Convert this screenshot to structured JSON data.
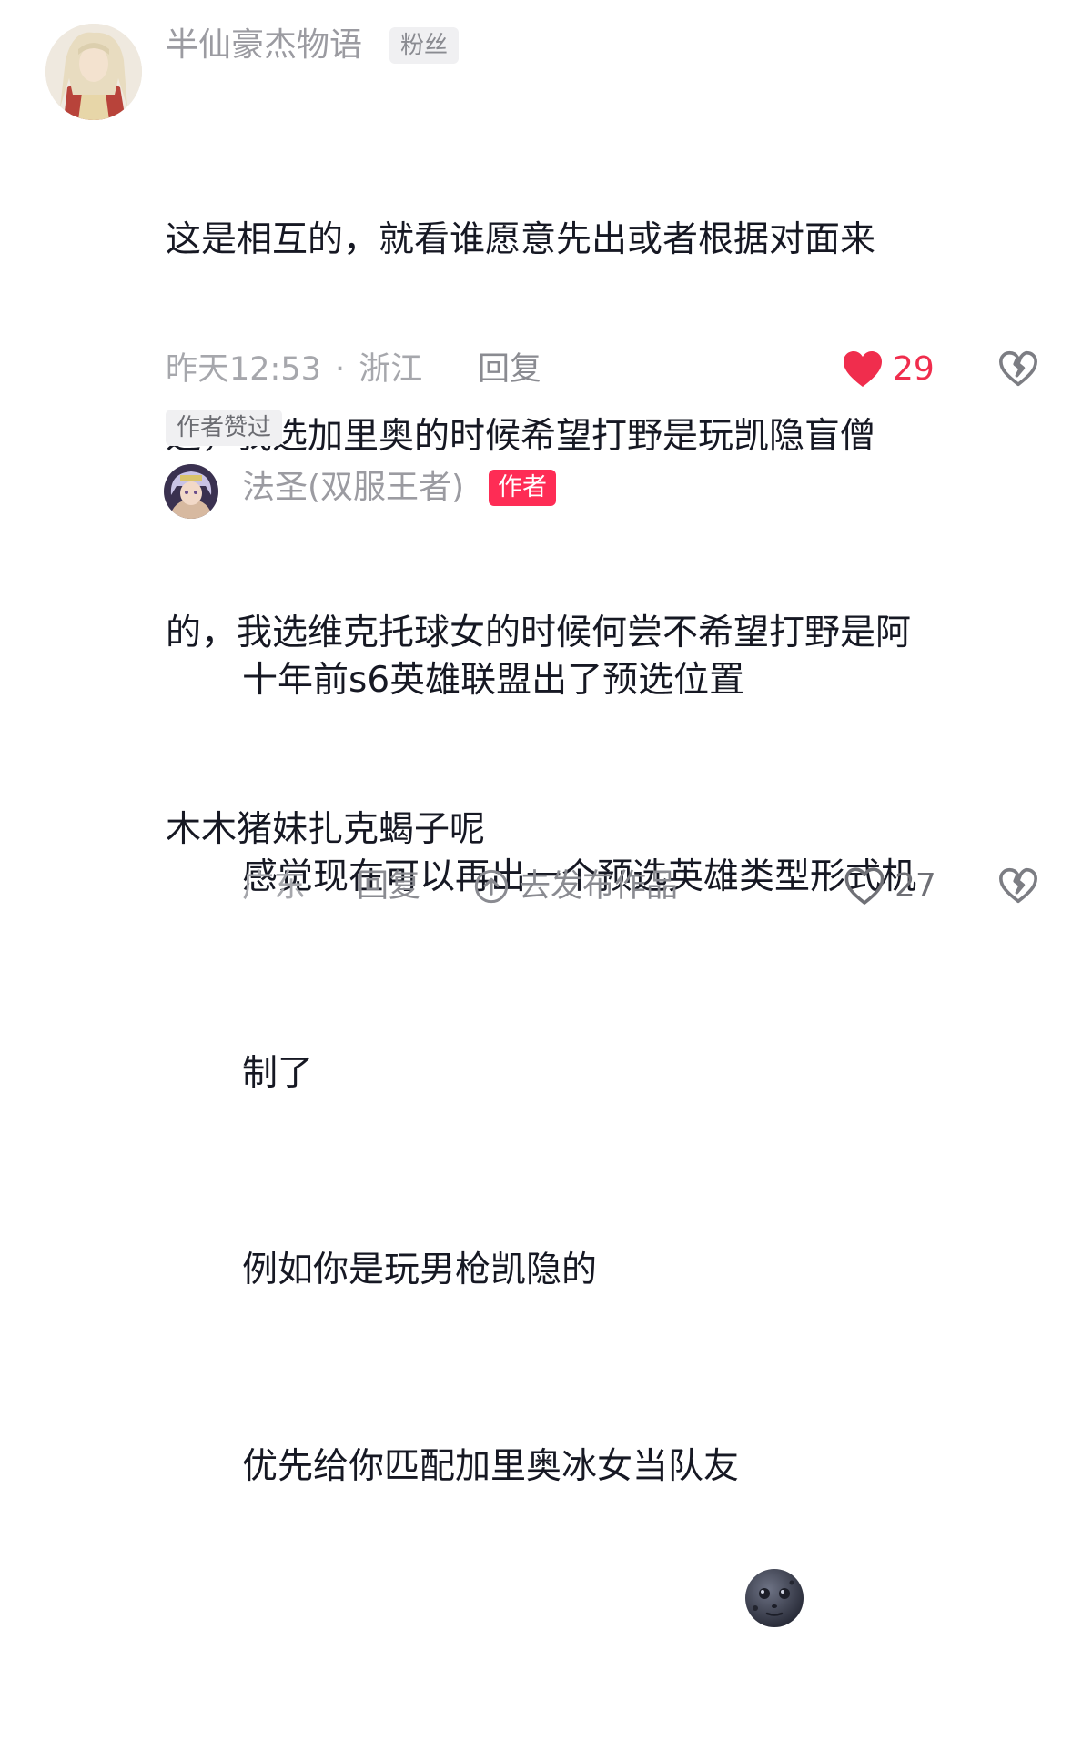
{
  "comment": {
    "username": "半仙豪杰物语",
    "fan_badge": "粉丝",
    "lines": [
      "这是相互的，就看谁愿意先出或者根据对面来",
      "选，我选加里奥的时候希望打野是玩凯隐盲僧",
      "的，我选维克托球女的时候何尝不希望打野是阿",
      "木木猪妹扎克蝎子呢"
    ],
    "time": "昨天12:53",
    "separator": "·",
    "location": "浙江",
    "reply_label": "回复",
    "like_count": "29",
    "author_liked_badge": "作者赞过"
  },
  "reply": {
    "username": "法圣(双服王者)",
    "author_badge": "作者",
    "lines": [
      "十年前s6英雄联盟出了预选位置",
      "感觉现在可以再出一个预选英雄类型形式机",
      "制了",
      "例如你是玩男枪凯隐的",
      "优先给你匹配加里奥冰女当队友"
    ],
    "location": "广东",
    "reply_label": "回复",
    "goto_work_label": "去发布作品",
    "like_count": "27"
  },
  "colors": {
    "accent_red": "#fe2c55",
    "liked_heart": "#f02d4d",
    "secondary_text": "#a6a7ac"
  },
  "icons": {
    "liked": "heart-filled-icon",
    "dislike": "broken-heart-icon",
    "unliked": "heart-outline-icon",
    "goto": "arrow-up-circle-icon",
    "emoji": "new-moon-face-emoji"
  }
}
